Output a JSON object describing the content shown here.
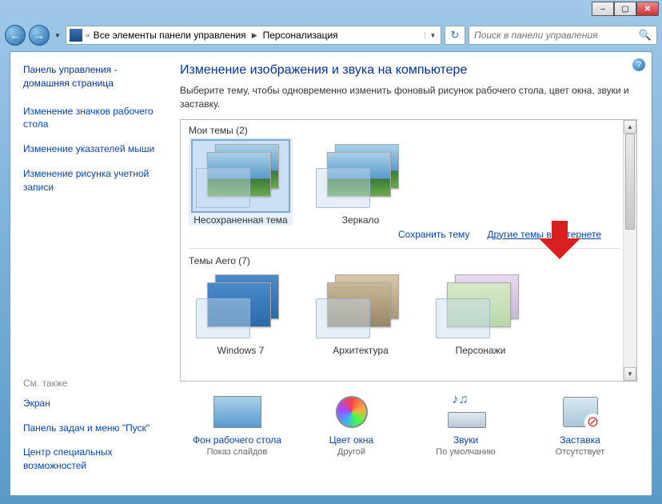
{
  "window": {
    "min": "–",
    "max": "▢",
    "close": "✕"
  },
  "breadcrumb": {
    "chevrons": "«",
    "item1": "Все элементы панели управления",
    "item2": "Персонализация"
  },
  "search": {
    "placeholder": "Поиск в панели управления"
  },
  "sidebar": {
    "home": "Панель управления - домашняя страница",
    "links": [
      "Изменение значков рабочего стола",
      "Изменение указателей мыши",
      "Изменение рисунка учетной записи"
    ],
    "see_also_heading": "См. также",
    "see_also": [
      "Экран",
      "Панель задач и меню \"Пуск\"",
      "Центр специальных возможностей"
    ]
  },
  "main": {
    "title": "Изменение изображения и звука на компьютере",
    "subtitle": "Выберите тему, чтобы одновременно изменить фоновый рисунок рабочего стола, цвет окна, звуки и заставку.",
    "group_my_themes": "Мои темы (2)",
    "themes_my": [
      {
        "label": "Несохраненная тема"
      },
      {
        "label": "Зеркало"
      }
    ],
    "link_save": "Сохранить тему",
    "link_online": "Другие темы в Интернете",
    "group_aero": "Темы Aero (7)",
    "themes_aero": [
      {
        "label": "Windows 7"
      },
      {
        "label": "Архитектура"
      },
      {
        "label": "Персонажи"
      }
    ]
  },
  "settings": {
    "bg": {
      "title": "Фон рабочего стола",
      "sub": "Показ слайдов"
    },
    "color": {
      "title": "Цвет окна",
      "sub": "Другой"
    },
    "sound": {
      "title": "Звуки",
      "sub": "По умолчанию"
    },
    "saver": {
      "title": "Заставка",
      "sub": "Отсутствует"
    }
  }
}
